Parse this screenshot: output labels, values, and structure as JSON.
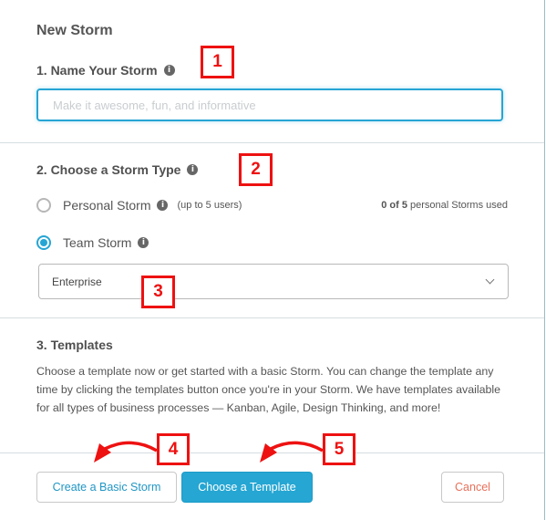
{
  "dialog": {
    "title": "New Storm",
    "section1": {
      "heading": "1. Name Your Storm",
      "info_icon": "info-icon",
      "name_input": {
        "value": "",
        "placeholder": "Make it awesome, fun, and informative"
      }
    },
    "section2": {
      "heading": "2. Choose a Storm Type",
      "info_icon": "info-icon",
      "options": [
        {
          "label": "Personal Storm",
          "note": "(up to 5 users)",
          "selected": false
        },
        {
          "label": "Team Storm",
          "note": "",
          "selected": true
        }
      ],
      "usage": {
        "count": "0 of 5",
        "suffix": " personal Storms used"
      },
      "plan_select": {
        "value": "Enterprise"
      }
    },
    "section3": {
      "heading": "3. Templates",
      "description": "Choose a template now or get started with a basic Storm. You can change the template any time by clicking the templates button once you're in your Storm. We have templates available for all types of business processes — Kanban, Agile, Design Thinking, and more!"
    },
    "footer": {
      "basic_button": "Create a Basic Storm",
      "template_button": "Choose a Template",
      "cancel_button": "Cancel"
    }
  },
  "annotations": [
    "1",
    "2",
    "3",
    "4",
    "5"
  ],
  "colors": {
    "accent": "#26a5d4",
    "cancel": "#e8705a",
    "annotation": "#ee1111"
  }
}
